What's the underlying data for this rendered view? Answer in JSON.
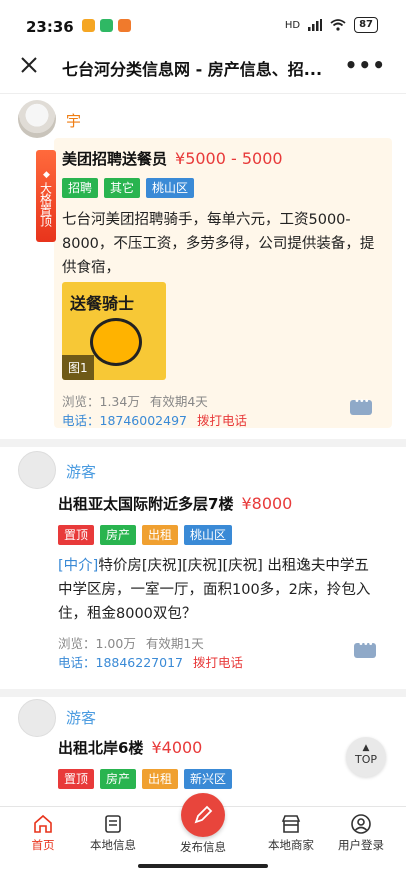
{
  "status_bar": {
    "time": "23:36",
    "battery": "87",
    "network": "HD"
  },
  "title_bar": {
    "title": "七台河分类信息网 - 房产信息、招..."
  },
  "posts": [
    {
      "username": "宇",
      "badge": "大格置顶",
      "title": "美团招聘送餐员",
      "price": "¥5000 - 5000",
      "tags": [
        {
          "label": "招聘",
          "color": "#29b44f"
        },
        {
          "label": "其它",
          "color": "#29b44f"
        },
        {
          "label": "桃山区",
          "color": "#3a8ad6"
        }
      ],
      "description": "七台河美团招聘骑手，每单六元，工资5000-8000，不压工资，多劳多得，公司提供装备，提供食宿，",
      "image_banner": "送餐骑士",
      "image_label": "图1",
      "views": "浏览：1.34万",
      "validity": "有效期4天",
      "phone": "电话：18746002497",
      "call": "拨打电话"
    },
    {
      "username": "游客",
      "title": "出租亚太国际附近多层7楼",
      "price": "¥8000",
      "tags": [
        {
          "label": "置顶",
          "color": "#e83a3a"
        },
        {
          "label": "房产",
          "color": "#29b44f"
        },
        {
          "label": "出租",
          "color": "#f0a030"
        },
        {
          "label": "桃山区",
          "color": "#3a8ad6"
        }
      ],
      "description_prefix": "[中介]",
      "description": "特价房[庆祝][庆祝][庆祝] 出租逸夫中学五中学区房，一室一厅，面积100多，2床，拎包入住，租金8000双包？",
      "views": "浏览：1.00万",
      "validity": "有效期1天",
      "phone": "电话：18846227017",
      "call": "拨打电话"
    },
    {
      "username": "游客",
      "title": "出租北岸6楼",
      "price": "¥4000",
      "tags": [
        {
          "label": "置顶",
          "color": "#e83a3a"
        },
        {
          "label": "房产",
          "color": "#29b44f"
        },
        {
          "label": "出租",
          "color": "#f0a030"
        },
        {
          "label": "新兴区",
          "color": "#3a8ad6"
        }
      ]
    }
  ],
  "top_button": {
    "label": "TOP"
  },
  "tab_bar": {
    "items": [
      {
        "label": "首页",
        "icon": "home-icon",
        "active": true
      },
      {
        "label": "本地信息",
        "icon": "document-icon"
      },
      {
        "label": "发布信息",
        "icon": "edit-icon"
      },
      {
        "label": "本地商家",
        "icon": "store-icon"
      },
      {
        "label": "用户登录",
        "icon": "user-icon"
      }
    ]
  }
}
